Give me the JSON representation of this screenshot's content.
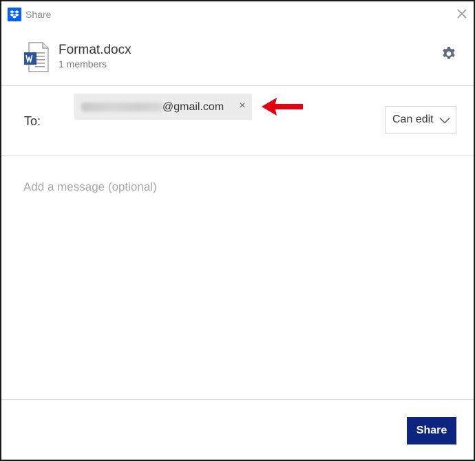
{
  "window": {
    "title": "Share",
    "app_icon": "dropbox-icon",
    "close_icon": "close-icon"
  },
  "file": {
    "name": "Format.docx",
    "members": "1 members",
    "icon": "word-document-icon",
    "settings_icon": "gear-icon"
  },
  "to": {
    "label": "To:",
    "recipient_email_suffix": "@gmail.com",
    "remove_symbol": "×",
    "permission": "Can edit"
  },
  "message": {
    "placeholder": "Add a message (optional)",
    "value": ""
  },
  "footer": {
    "share_label": "Share"
  },
  "colors": {
    "brand": "#0061fe",
    "primary_button": "#0d2481",
    "annotation_arrow": "#e3000f"
  }
}
